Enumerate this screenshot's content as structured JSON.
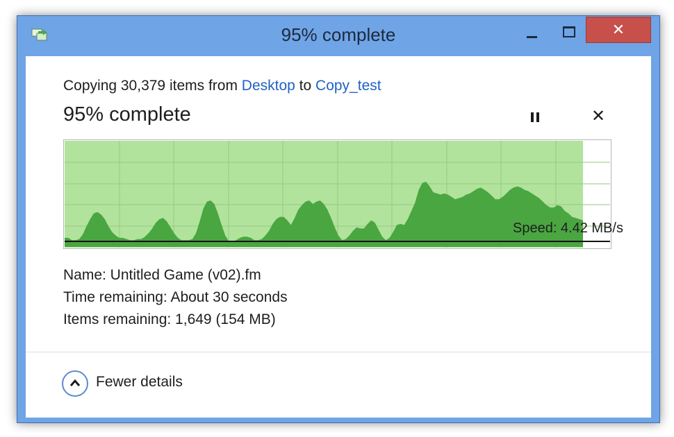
{
  "window": {
    "title": "95% complete",
    "close_glyph": "✕",
    "icons": {
      "app": "copy-files-icon",
      "minimize": "minimize-icon",
      "maximize": "maximize-icon",
      "close": "close-icon"
    },
    "colors": {
      "titlebar": "#6fa4e6",
      "close": "#c7504b"
    }
  },
  "copy": {
    "prefix": "Copying 30,379 items from ",
    "source": "Desktop",
    "mid": " to ",
    "destination": "Copy_test"
  },
  "progress": {
    "title": "95% complete",
    "percent": 95,
    "cancel_glyph": "✕"
  },
  "speed": {
    "label": "Speed: 4.42 MB/s",
    "value_mb_s": 4.42
  },
  "speed_graph": {
    "fill_color": "#b1e39d",
    "grid_color": "#95c97f",
    "area_color": "#4aa640",
    "history": [
      6,
      6,
      4,
      4,
      5,
      9,
      16,
      22,
      27,
      28,
      26,
      22,
      16,
      11,
      8,
      6,
      6,
      5,
      4,
      4,
      5,
      5,
      7,
      10,
      14,
      19,
      22,
      23,
      20,
      15,
      10,
      6,
      4,
      4,
      4,
      5,
      10,
      20,
      31,
      37,
      38,
      35,
      27,
      17,
      8,
      3,
      3,
      4,
      6,
      7,
      7,
      6,
      4,
      4,
      5,
      8,
      12,
      18,
      22,
      24,
      24,
      21,
      17,
      23,
      30,
      34,
      37,
      38,
      35,
      37,
      38,
      35,
      30,
      23,
      15,
      8,
      4,
      5,
      8,
      12,
      15,
      14,
      14,
      18,
      21,
      19,
      13,
      7,
      4,
      6,
      11,
      17,
      18,
      17,
      22,
      29,
      36,
      47,
      53,
      54,
      50,
      45,
      44,
      43,
      44,
      43,
      41,
      39,
      40,
      41,
      43,
      44,
      46,
      48,
      49,
      47,
      45,
      42,
      39,
      39,
      41,
      44,
      47,
      49,
      50,
      49,
      47,
      46,
      44,
      42,
      40,
      37,
      34,
      32,
      32,
      34,
      33,
      29,
      27,
      24,
      23,
      22,
      21
    ]
  },
  "details": {
    "name": "Name:  Untitled Game (v02).fm",
    "time_remaining": "Time remaining:  About 30 seconds",
    "items_remaining": "Items remaining:  1,649 (154 MB)"
  },
  "footer": {
    "toggle_label": "Fewer details",
    "toggle_icon": "chevron-up-icon"
  }
}
